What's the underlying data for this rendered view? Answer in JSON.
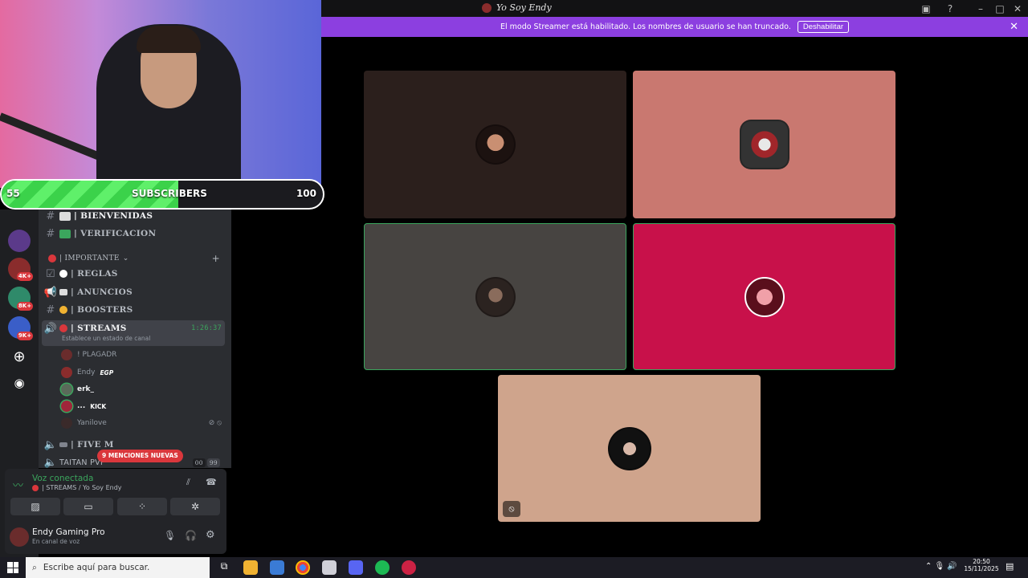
{
  "window": {
    "title": "Yo Soy Endy"
  },
  "banner": {
    "text": "El modo Streamer está habilitado. Los nombres de usuario se han truncado.",
    "button": "Deshabilitar"
  },
  "overlay": {
    "current": "55",
    "label": "SUBSCRIBERS",
    "goal": "100",
    "progress_fraction": 0.55
  },
  "guilds": {
    "badges": [
      "4K+",
      "8K+",
      "9K+"
    ]
  },
  "channels": {
    "items": [
      {
        "hash": "#",
        "label": "| BIENVENIDAS"
      },
      {
        "hash": "#",
        "label": "| VERIFICACION"
      },
      {
        "category": "| IMPORTANTE"
      },
      {
        "label": "| REGLAS"
      },
      {
        "label": "| ANUNCIOS"
      },
      {
        "hash": "#",
        "label": "| BOOSTERS"
      }
    ],
    "active_voice": {
      "label": "| STREAMS",
      "timer": "1:26:37",
      "status": "Establece un estado de canal"
    },
    "members": [
      {
        "name": "! PLAGADR"
      },
      {
        "name": "Endy",
        "tag": "EGP"
      },
      {
        "name": "erk_"
      },
      {
        "name": "...",
        "tag": "KICK"
      },
      {
        "name": "Yanilove"
      }
    ],
    "more_voice": [
      {
        "label": "| FIVE M"
      },
      {
        "label": "TAITAN PVP",
        "counts": [
          "00",
          "99"
        ]
      }
    ],
    "mentions": "9 MENCIONES NUEVAS"
  },
  "voice": {
    "status": "Voz conectada",
    "channel": "| STREAMS / Yo Soy Endy"
  },
  "user": {
    "name": "Endy Gaming Pro",
    "status": "En canal de voz"
  },
  "taskbar": {
    "search_placeholder": "Escribe aquí para buscar.",
    "time": "20:50",
    "date": "15/11/2025"
  },
  "colors": {
    "accent": "#8c3fe0",
    "speaking": "#3ba55d",
    "tile1": "#2b1f1c",
    "tile2": "#c97870",
    "tile3": "#474441",
    "tile4": "#c8114a",
    "tile5": "#cfa48c"
  }
}
